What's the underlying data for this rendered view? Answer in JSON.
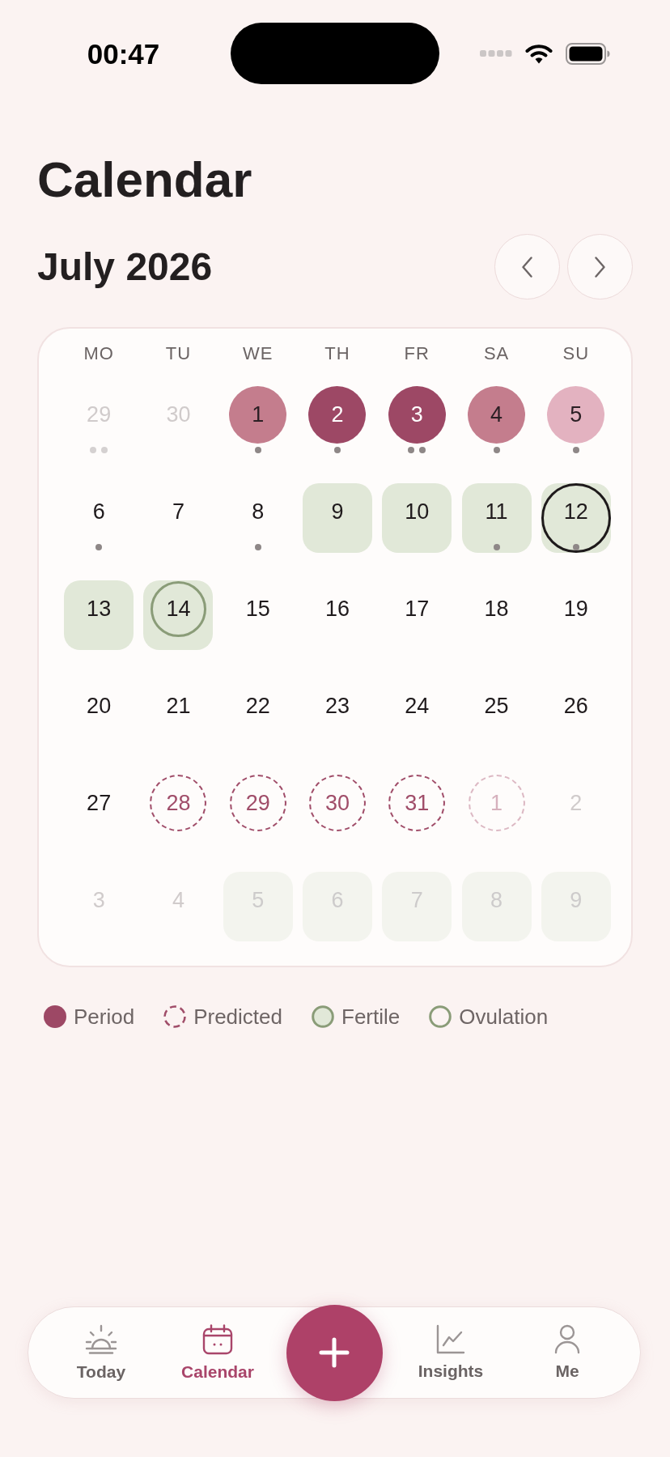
{
  "status_bar": {
    "time": "00:47"
  },
  "header": {
    "title": "Calendar",
    "month": "July 2026"
  },
  "calendar": {
    "weekdays": [
      "MO",
      "TU",
      "WE",
      "TH",
      "FR",
      "SA",
      "SU"
    ],
    "weeks": [
      [
        {
          "label": "29",
          "kind": "plain",
          "outside": true,
          "selected": false,
          "dots": [
            {
              "color": "#d5d1d1"
            },
            {
              "color": "#d5d1d1"
            }
          ]
        },
        {
          "label": "30",
          "kind": "plain",
          "outside": true,
          "selected": false
        },
        {
          "label": "1",
          "kind": "period",
          "color": "#c47d8d",
          "outside": false,
          "selected": false,
          "dots": [
            {
              "color": "#8e8787"
            }
          ]
        },
        {
          "label": "2",
          "kind": "period",
          "color": "#9d4865",
          "outside": false,
          "selected": false,
          "dots": [
            {
              "color": "#8e8787"
            }
          ]
        },
        {
          "label": "3",
          "kind": "period",
          "color": "#9d4865",
          "outside": false,
          "selected": false,
          "dots": [
            {
              "color": "#8e8787"
            },
            {
              "color": "#8e8787"
            }
          ]
        },
        {
          "label": "4",
          "kind": "period",
          "color": "#c47d8d",
          "outside": false,
          "selected": false,
          "dots": [
            {
              "color": "#8e8787"
            }
          ]
        },
        {
          "label": "5",
          "kind": "period",
          "color": "#e3b2c0",
          "outside": false,
          "selected": false,
          "dots": [
            {
              "color": "#8e8787"
            }
          ]
        }
      ],
      [
        {
          "label": "6",
          "kind": "plain",
          "outside": false,
          "selected": false,
          "dots": [
            {
              "color": "#8e8787"
            }
          ]
        },
        {
          "label": "7",
          "kind": "plain",
          "outside": false,
          "selected": false
        },
        {
          "label": "8",
          "kind": "plain",
          "outside": false,
          "selected": false,
          "dots": [
            {
              "color": "#8e8787"
            }
          ]
        },
        {
          "label": "9",
          "kind": "fertile",
          "outside": false,
          "selected": false
        },
        {
          "label": "10",
          "kind": "fertile",
          "outside": false,
          "selected": false
        },
        {
          "label": "11",
          "kind": "fertile",
          "outside": false,
          "selected": false,
          "dots": [
            {
              "color": "#8e8787"
            }
          ]
        },
        {
          "label": "12",
          "kind": "fertile",
          "outside": false,
          "selected": true,
          "dots": [
            {
              "color": "#8e8787"
            }
          ]
        }
      ],
      [
        {
          "label": "13",
          "kind": "fertile",
          "outside": false,
          "selected": false
        },
        {
          "label": "14",
          "kind": "ovulation",
          "outside": false,
          "selected": false
        },
        {
          "label": "15",
          "kind": "plain",
          "outside": false,
          "selected": false
        },
        {
          "label": "16",
          "kind": "plain",
          "outside": false,
          "selected": false
        },
        {
          "label": "17",
          "kind": "plain",
          "outside": false,
          "selected": false
        },
        {
          "label": "18",
          "kind": "plain",
          "outside": false,
          "selected": false
        },
        {
          "label": "19",
          "kind": "plain",
          "outside": false,
          "selected": false
        }
      ],
      [
        {
          "label": "20",
          "kind": "plain",
          "outside": false,
          "selected": false
        },
        {
          "label": "21",
          "kind": "plain",
          "outside": false,
          "selected": false
        },
        {
          "label": "22",
          "kind": "plain",
          "outside": false,
          "selected": false
        },
        {
          "label": "23",
          "kind": "plain",
          "outside": false,
          "selected": false
        },
        {
          "label": "24",
          "kind": "plain",
          "outside": false,
          "selected": false
        },
        {
          "label": "25",
          "kind": "plain",
          "outside": false,
          "selected": false
        },
        {
          "label": "26",
          "kind": "plain",
          "outside": false,
          "selected": false
        }
      ],
      [
        {
          "label": "27",
          "kind": "plain",
          "outside": false,
          "selected": false
        },
        {
          "label": "28",
          "kind": "predicted",
          "outside": false,
          "selected": false
        },
        {
          "label": "29",
          "kind": "predicted",
          "outside": false,
          "selected": false
        },
        {
          "label": "30",
          "kind": "predicted",
          "outside": false,
          "selected": false
        },
        {
          "label": "31",
          "kind": "predicted",
          "outside": false,
          "selected": false
        },
        {
          "label": "1",
          "kind": "predicted",
          "outside": true,
          "selected": false
        },
        {
          "label": "2",
          "kind": "plain",
          "outside": true,
          "selected": false
        }
      ],
      [
        {
          "label": "3",
          "kind": "plain",
          "outside": true,
          "selected": false
        },
        {
          "label": "4",
          "kind": "plain",
          "outside": true,
          "selected": false
        },
        {
          "label": "5",
          "kind": "fertile",
          "outside": true,
          "selected": false
        },
        {
          "label": "6",
          "kind": "fertile",
          "outside": true,
          "selected": false
        },
        {
          "label": "7",
          "kind": "fertile",
          "outside": true,
          "selected": false
        },
        {
          "label": "8",
          "kind": "fertile",
          "outside": true,
          "selected": false
        },
        {
          "label": "9",
          "kind": "fertile",
          "outside": true,
          "selected": false
        }
      ]
    ]
  },
  "legend": [
    {
      "label": "Period",
      "kind": "period"
    },
    {
      "label": "Predicted",
      "kind": "predicted"
    },
    {
      "label": "Fertile",
      "kind": "fertile"
    },
    {
      "label": "Ovulation",
      "kind": "ovulation"
    }
  ],
  "nav": {
    "tabs": [
      {
        "label": "Today",
        "kind": "today",
        "selected": false
      },
      {
        "label": "Calendar",
        "kind": "calendar",
        "selected": true
      },
      {
        "label": "Insights",
        "kind": "insights",
        "selected": false
      },
      {
        "label": "Me",
        "kind": "profile",
        "selected": false
      }
    ]
  }
}
